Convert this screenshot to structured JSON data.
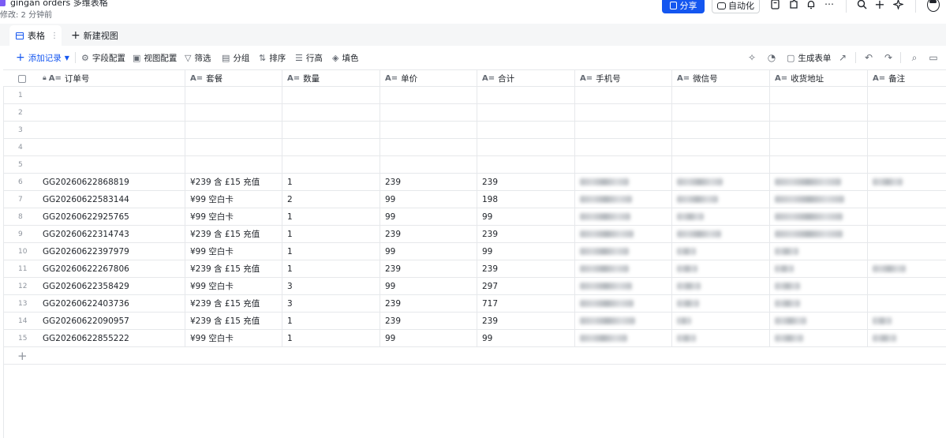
{
  "doc": {
    "title": "gingan orders 多维表格",
    "subtitle": "修改: 2 分钟前"
  },
  "topbar": {
    "share_label": "分享",
    "automation_label": "自动化"
  },
  "tabs": [
    {
      "label": "表格",
      "active": true
    },
    {
      "label": "新建视图",
      "active": false
    }
  ],
  "toolbar": {
    "add_record": "添加记录",
    "field_config": "字段配置",
    "view_config": "视图配置",
    "filter": "筛选",
    "group": "分组",
    "sort": "排序",
    "row_height": "行高",
    "fill_color": "填色",
    "generate_form": "生成表单"
  },
  "columns": [
    "订单号",
    "套餐",
    "数量",
    "单价",
    "合计",
    "手机号",
    "微信号",
    "收货地址",
    "备注"
  ],
  "rows": [
    {
      "num": "1",
      "order": "",
      "package": "",
      "qty": "",
      "price": "",
      "total": ""
    },
    {
      "num": "2",
      "order": "",
      "package": "",
      "qty": "",
      "price": "",
      "total": ""
    },
    {
      "num": "3",
      "order": "",
      "package": "",
      "qty": "",
      "price": "",
      "total": ""
    },
    {
      "num": "4",
      "order": "",
      "package": "",
      "qty": "",
      "price": "",
      "total": ""
    },
    {
      "num": "5",
      "order": "",
      "package": "",
      "qty": "",
      "price": "",
      "total": ""
    },
    {
      "num": "6",
      "order": "GG20260622868819",
      "package": "¥239 含 £15 充值",
      "qty": "1",
      "price": "239",
      "total": "239"
    },
    {
      "num": "7",
      "order": "GG20260622583144",
      "package": "¥99 空白卡",
      "qty": "2",
      "price": "99",
      "total": "198"
    },
    {
      "num": "8",
      "order": "GG20260622925765",
      "package": "¥99 空白卡",
      "qty": "1",
      "price": "99",
      "total": "99"
    },
    {
      "num": "9",
      "order": "GG20260622314743",
      "package": "¥239 含 £15 充值",
      "qty": "1",
      "price": "239",
      "total": "239"
    },
    {
      "num": "10",
      "order": "GG20260622397979",
      "package": "¥99 空白卡",
      "qty": "1",
      "price": "99",
      "total": "99"
    },
    {
      "num": "11",
      "order": "GG20260622267806",
      "package": "¥239 含 £15 充值",
      "qty": "1",
      "price": "239",
      "total": "239"
    },
    {
      "num": "12",
      "order": "GG20260622358429",
      "package": "¥99 空白卡",
      "qty": "3",
      "price": "99",
      "total": "297"
    },
    {
      "num": "13",
      "order": "GG20260622403736",
      "package": "¥239 含 £15 充值",
      "qty": "3",
      "price": "239",
      "total": "717"
    },
    {
      "num": "14",
      "order": "GG20260622090957",
      "package": "¥239 含 £15 充值",
      "qty": "1",
      "price": "239",
      "total": "239"
    },
    {
      "num": "15",
      "order": "GG20260622855222",
      "package": "¥99 空白卡",
      "qty": "1",
      "price": "99",
      "total": "99"
    }
  ],
  "colors": {
    "accent": "#1456f0",
    "border": "#e6e8eb",
    "muted_text": "#8f959e"
  }
}
